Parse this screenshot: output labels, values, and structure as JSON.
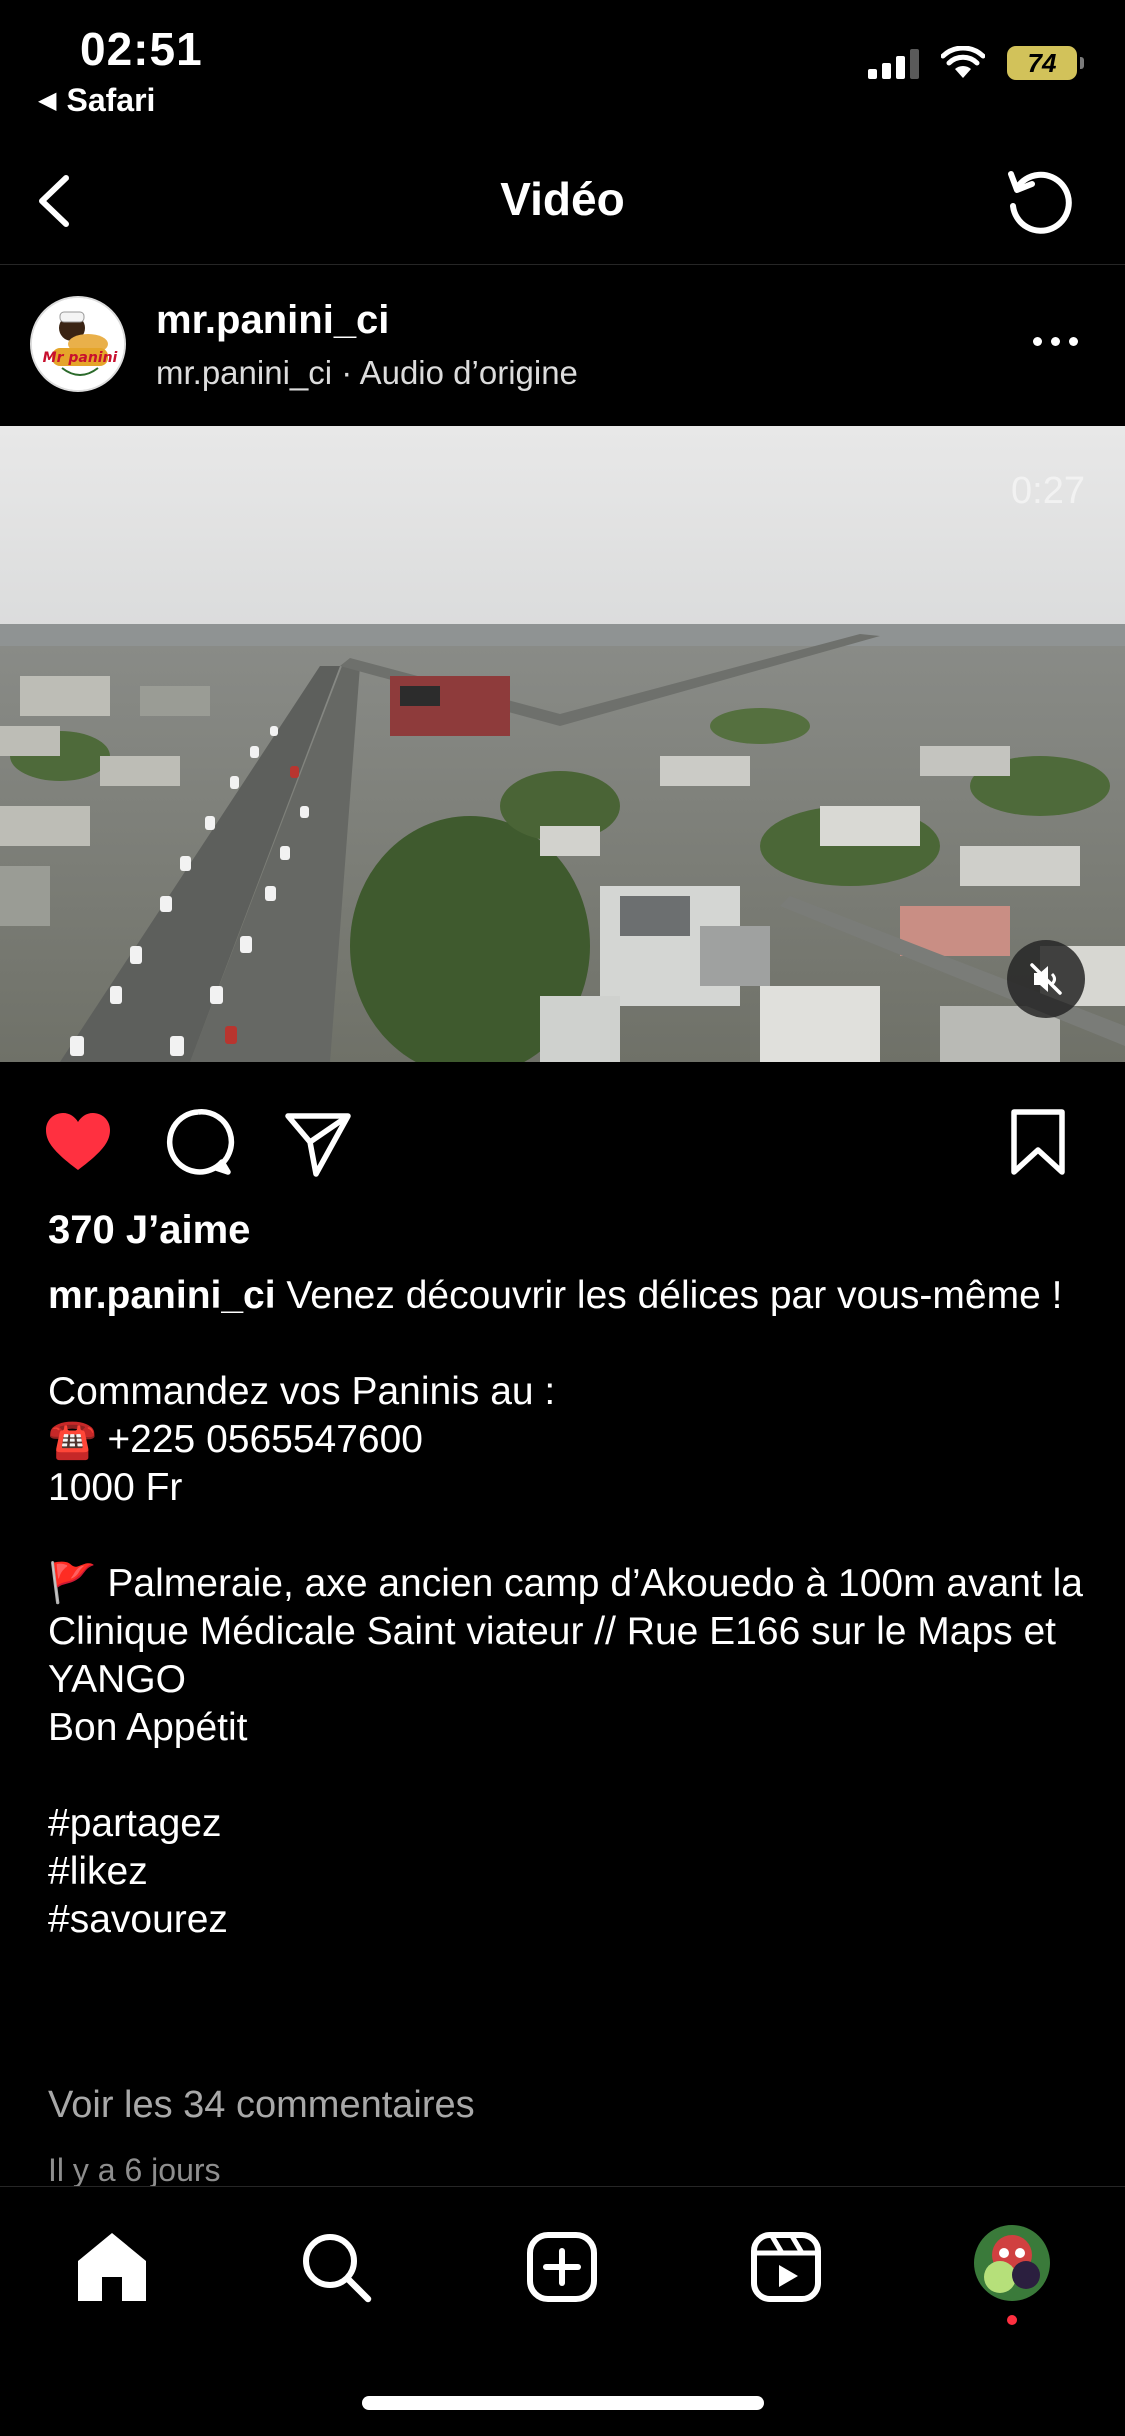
{
  "status_bar": {
    "time": "02:51",
    "back_app": "Safari",
    "battery": "74"
  },
  "nav": {
    "title": "Vidéo",
    "back_icon": "chevron-left-icon",
    "refresh_icon": "refresh-icon"
  },
  "post": {
    "username": "mr.panini_ci",
    "subtitle": "mr.panini_ci · Audio d’origine",
    "avatar_text": "Mr panini",
    "duration": "0:27",
    "likes": "370 J’aime",
    "caption_user": "mr.panini_ci",
    "caption_text": " Venez découvrir les délices par vous-même !\n\nCommandez vos Paninis au :\n☎️ +225 0565547600\n1000 Fr\n\n🚩 Palmeraie, axe ancien camp d’Akouedo à 100m avant la Clinique Médicale Saint viateur // Rue E166 sur le Maps et YANGO\nBon Appétit\n\n#partagez\n#likez\n#savourez",
    "comments_link": "Voir les 34 commentaires",
    "time_ago": "Il y a 6 jours"
  },
  "colors": {
    "like": "#ff3040",
    "background": "#000000",
    "secondary_text": "#a8a8a8"
  }
}
